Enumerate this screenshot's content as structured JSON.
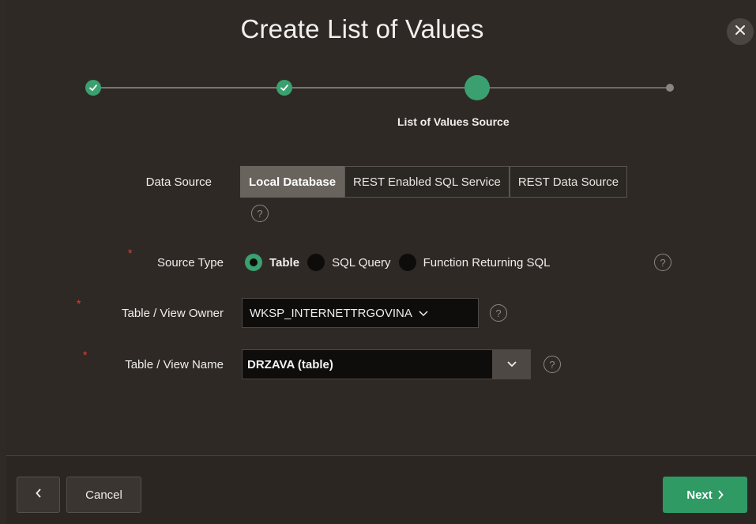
{
  "dialog": {
    "title": "Create List of Values",
    "close_icon": "close-icon"
  },
  "wizard": {
    "steps_completed": 2,
    "current_step_label": "List of Values Source",
    "total_steps": 4
  },
  "form": {
    "data_source": {
      "label": "Data Source",
      "options": [
        "Local Database",
        "REST Enabled SQL Service",
        "REST Data Source"
      ],
      "selected": "Local Database"
    },
    "source_type": {
      "label": "Source Type",
      "required": true,
      "options": [
        "Table",
        "SQL Query",
        "Function Returning SQL"
      ],
      "selected": "Table"
    },
    "table_owner": {
      "label": "Table / View Owner",
      "required": true,
      "value": "WKSP_INTERNETTRGOVINA"
    },
    "table_name": {
      "label": "Table / View Name",
      "required": true,
      "value": "DRZAVA (table)"
    },
    "required_marker": "*",
    "help_glyph": "?"
  },
  "footer": {
    "back_glyph": "<",
    "cancel_label": "Cancel",
    "next_label": "Next",
    "next_glyph": ">"
  },
  "colors": {
    "background": "#2f2a26",
    "accent_green": "#3aa070",
    "segment_active": "#69635d",
    "required_red": "#e0403a"
  }
}
